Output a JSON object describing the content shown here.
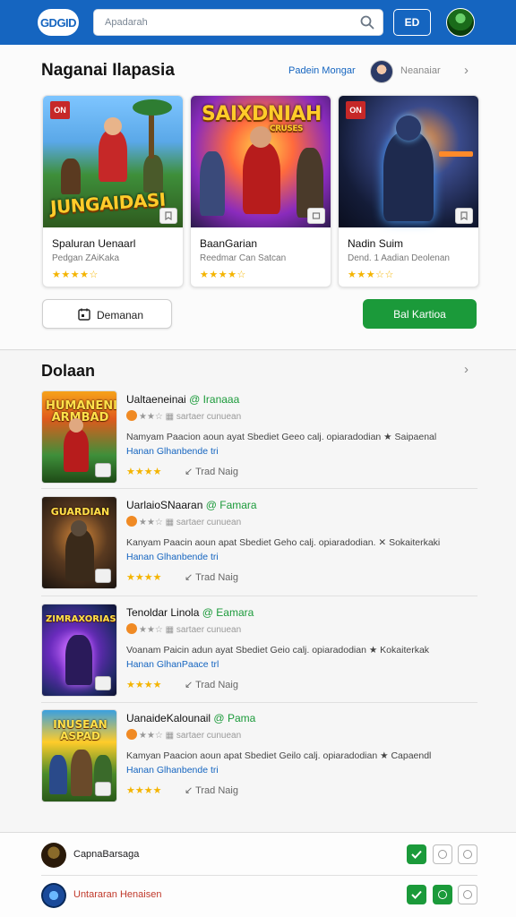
{
  "topbar": {
    "logo_text": "GDGID",
    "search_placeholder": "Apadarah",
    "ed_button": "ED"
  },
  "featured": {
    "title": "Naganai Ilapasia",
    "link": "Padein Mongar",
    "username": "Neanaiar",
    "cards": [
      {
        "badge": "ON",
        "art_text": "JUNGAIDASI",
        "title": "Spaluran Uenaarl",
        "subtitle": "Pedgan ZAiKaka",
        "stars": "★★★★☆"
      },
      {
        "badge": "",
        "art_text": "SAIXDNIAH",
        "art_sub": "CRUSES",
        "title": "BaanGarian",
        "subtitle": "Reedmar Can Satcan",
        "stars": "★★★★☆"
      },
      {
        "badge": "ON",
        "art_text": "",
        "title": "Nadin Suim",
        "subtitle": "Dend. 1 Aadian Deolenan",
        "stars": "★★★☆☆"
      }
    ],
    "btn_outline": "Demanan",
    "btn_green": "Bal Kartioa"
  },
  "list": {
    "title": "Dolaan",
    "rows": [
      {
        "thumb_text": "HUMANENIH ARMBAD",
        "title": "Ualtaeneinai",
        "tag": "@ Iranaaa",
        "meta": "★★☆ ▦ sartaer cunuean",
        "desc": "Namyam Paacion aoun ayat Sbediet Geeo calj. opiaradodian ★ Saipaenal",
        "link": "Hanan Glhanbende tri",
        "stars": "★★★★",
        "trad": "↙   Trad Naig"
      },
      {
        "thumb_text": "GUARDIAN",
        "title": "UarlaioSNaaran",
        "tag": "@ Famara",
        "meta": "★★☆ ▦ sartaer cunuean",
        "desc": "Kanyam Paacin aoun apat Sbediet Geho calj. opiaradodian. ✕ Sokaiterkaki",
        "link": "Hanan Glhanbende tri",
        "stars": "★★★★",
        "trad": "↙   Trad Naig"
      },
      {
        "thumb_text": "ZIMRAXORIAS",
        "title": "Tenoldar Linola",
        "tag": "@ Eamara",
        "meta": "★★☆ ▦ sartaer cunuean",
        "desc": "Voanam Paicin adun ayat Sbediet Geio calj. opiaradodian ★ Kokaiterkak",
        "link": "Hanan GlhanPaace trl",
        "stars": "★★★★",
        "trad": "↙   Trad Naig"
      },
      {
        "thumb_text": "INUSEAN ASPAD",
        "title": "UanaideKalounail",
        "tag": "@ Pama",
        "meta": "★★☆ ▦ sartaer cunuean",
        "desc": "Kamyan Paacion aoun apat Sbediet Geilo calj. opiaradodian ★ Capaendl",
        "link": "Hanan Glhanbende tri",
        "stars": "★★★★",
        "trad": "↙   Trad Naig"
      }
    ]
  },
  "bottom": {
    "rows": [
      {
        "label": "CapnaBarsaga",
        "color": "#1d1d1f"
      },
      {
        "label": "Untararan Henaisen",
        "color": "#c0392b"
      }
    ]
  },
  "colors": {
    "primary": "#1565c0",
    "accent_green": "#1b9a3a",
    "star": "#f4b400"
  },
  "icons": [
    "search-icon",
    "calendar-icon",
    "bookmark-icon",
    "chevron-right-icon",
    "check-icon",
    "circle-icon",
    "trend-icon"
  ]
}
